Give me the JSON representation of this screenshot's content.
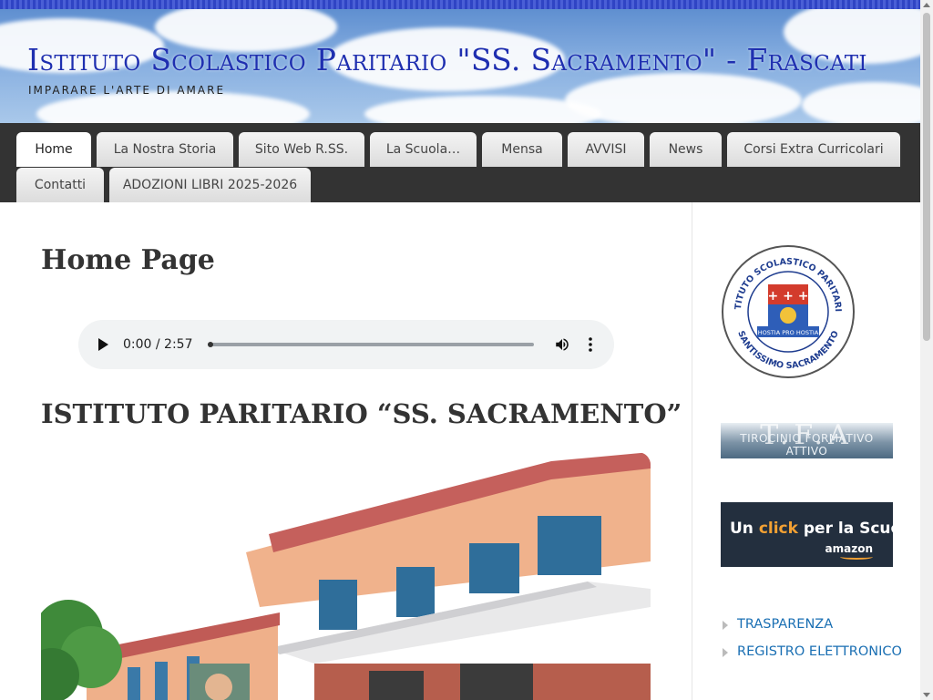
{
  "header": {
    "site_title": "Istituto Scolastico Paritario \"SS. Sacramento\" - Frascati",
    "tagline": "Imparare l'arte di amare"
  },
  "nav": {
    "items": [
      {
        "label": "Home",
        "active": true
      },
      {
        "label": "La Nostra Storia"
      },
      {
        "label": "Sito Web R.SS."
      },
      {
        "label": "La Scuola…"
      },
      {
        "label": "Mensa"
      },
      {
        "label": "AVVISI"
      },
      {
        "label": "News"
      },
      {
        "label": "Corsi Extra Curricolari"
      },
      {
        "label": "Contatti"
      },
      {
        "label": "ADOZIONI LIBRI 2025-2026"
      }
    ]
  },
  "main": {
    "page_title": "Home Page",
    "audio": {
      "time": "0:00 / 2:57",
      "progress": 0
    },
    "section_title": "ISTITUTO PARITARIO “SS. SACRAMENTO”"
  },
  "sidebar": {
    "logo_text_top": "ISTITUTO SCOLASTICO PARITARIO",
    "logo_text_bottom": "SANTISSIMO SACRAMENTO",
    "logo_motto": "HOSTIA PRO HOSTIA",
    "tfa_letters": "T.F.A",
    "tfa_caption": "TIROCINIO FORMATIVO ATTIVO",
    "amazon_pre": "Un ",
    "amazon_click": "click",
    "amazon_post": " per la Scuola",
    "amazon_brand": "amazon",
    "links": [
      "TRASPARENZA",
      "REGISTRO ELETTRONICO"
    ]
  },
  "colors": {
    "title_blue": "#1f2fb0",
    "nav_bg": "#333333",
    "link_blue": "#1a6fb3",
    "amazon_dark": "#232f3e",
    "amazon_orange": "#f3a133"
  },
  "icons": [
    "play-icon",
    "volume-icon",
    "more-vert-icon",
    "bullet-arrow-icon"
  ]
}
